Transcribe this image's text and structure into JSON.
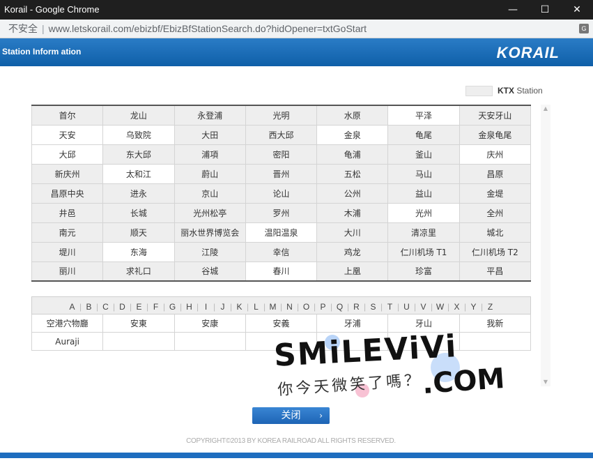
{
  "window": {
    "title": "Korail - Google Chrome",
    "minimize": "—",
    "maximize": "☐",
    "close": "✕"
  },
  "address": {
    "security": "不安全",
    "separator": "|",
    "url": "www.letskorail.com/ebizbf/EbizBfStationSearch.do?hidOpener=txtGoStart",
    "translate": "G"
  },
  "header": {
    "title": "Station Inform ation",
    "logo": "KORAIL"
  },
  "legend": {
    "ktx": "KTX",
    "station": "Station"
  },
  "stations": [
    [
      {
        "name": "首尔",
        "ktx": true
      },
      {
        "name": "龙山",
        "ktx": true
      },
      {
        "name": "永登浦",
        "ktx": true
      },
      {
        "name": "光明",
        "ktx": true
      },
      {
        "name": "水原",
        "ktx": true
      },
      {
        "name": "平泽",
        "ktx": false
      },
      {
        "name": "天安牙山",
        "ktx": true
      }
    ],
    [
      {
        "name": "天安",
        "ktx": false
      },
      {
        "name": "乌致院",
        "ktx": false
      },
      {
        "name": "大田",
        "ktx": true
      },
      {
        "name": "西大邱",
        "ktx": true
      },
      {
        "name": "金泉",
        "ktx": false
      },
      {
        "name": "龟尾",
        "ktx": true
      },
      {
        "name": "金泉龟尾",
        "ktx": true
      }
    ],
    [
      {
        "name": "大邱",
        "ktx": false
      },
      {
        "name": "东大邱",
        "ktx": true
      },
      {
        "name": "浦項",
        "ktx": true
      },
      {
        "name": "密阳",
        "ktx": true
      },
      {
        "name": "龟浦",
        "ktx": true
      },
      {
        "name": "釜山",
        "ktx": true
      },
      {
        "name": "庆州",
        "ktx": false
      }
    ],
    [
      {
        "name": "新庆州",
        "ktx": true
      },
      {
        "name": "太和江",
        "ktx": false
      },
      {
        "name": "蔚山",
        "ktx": true
      },
      {
        "name": "晋州",
        "ktx": true
      },
      {
        "name": "五松",
        "ktx": true
      },
      {
        "name": "马山",
        "ktx": true
      },
      {
        "name": "昌原",
        "ktx": true
      }
    ],
    [
      {
        "name": "昌原中央",
        "ktx": true
      },
      {
        "name": "进永",
        "ktx": true
      },
      {
        "name": "京山",
        "ktx": true
      },
      {
        "name": "论山",
        "ktx": true
      },
      {
        "name": "公州",
        "ktx": true
      },
      {
        "name": "益山",
        "ktx": true
      },
      {
        "name": "金堤",
        "ktx": true
      }
    ],
    [
      {
        "name": "井邑",
        "ktx": true
      },
      {
        "name": "长城",
        "ktx": true
      },
      {
        "name": "光州松亭",
        "ktx": true
      },
      {
        "name": "罗州",
        "ktx": true
      },
      {
        "name": "木浦",
        "ktx": true
      },
      {
        "name": "光州",
        "ktx": false
      },
      {
        "name": "全州",
        "ktx": true
      }
    ],
    [
      {
        "name": "南元",
        "ktx": true
      },
      {
        "name": "顺天",
        "ktx": true
      },
      {
        "name": "丽水世界博览会",
        "ktx": true
      },
      {
        "name": "温阳温泉",
        "ktx": false
      },
      {
        "name": "大川",
        "ktx": true
      },
      {
        "name": "清凉里",
        "ktx": true
      },
      {
        "name": "城北",
        "ktx": true
      }
    ],
    [
      {
        "name": "堤川",
        "ktx": true
      },
      {
        "name": "东海",
        "ktx": false
      },
      {
        "name": "江陵",
        "ktx": true
      },
      {
        "name": "幸信",
        "ktx": true
      },
      {
        "name": "鸡龙",
        "ktx": true
      },
      {
        "name": "仁川机场 T1",
        "ktx": true
      },
      {
        "name": "仁川机场 T2",
        "ktx": true
      }
    ],
    [
      {
        "name": "丽川",
        "ktx": true
      },
      {
        "name": "求礼口",
        "ktx": true
      },
      {
        "name": "谷城",
        "ktx": true
      },
      {
        "name": "春川",
        "ktx": false
      },
      {
        "name": "上凰",
        "ktx": true
      },
      {
        "name": "珍富",
        "ktx": true
      },
      {
        "name": "平昌",
        "ktx": true
      }
    ]
  ],
  "alphabet": [
    "A",
    "B",
    "C",
    "D",
    "E",
    "F",
    "G",
    "H",
    "I",
    "J",
    "K",
    "L",
    "M",
    "N",
    "O",
    "P",
    "Q",
    "R",
    "S",
    "T",
    "U",
    "V",
    "W",
    "X",
    "Y",
    "Z"
  ],
  "results": [
    [
      "空港穴物廳",
      "安東",
      "安康",
      "安義",
      "牙浦",
      "牙山",
      "我新"
    ],
    [
      "Auraji",
      "",
      "",
      "",
      "",
      "",
      ""
    ]
  ],
  "close_button": {
    "label": "关闭",
    "chevron": "›"
  },
  "copyright": "COPYRIGHT©2013 BY KOREA RAILROAD ALL RIGHTS RESERVED.",
  "watermark": {
    "line1": "SMiLEViVi",
    "line2": "你今天微笑了嗎？",
    "line3": ".COM"
  },
  "scroll": {
    "up": "▲",
    "down": "▼"
  },
  "colors": {
    "header_blue": "#1565b0",
    "ktx_cell": "#eeeeee",
    "button_blue": "#2a74c4"
  }
}
